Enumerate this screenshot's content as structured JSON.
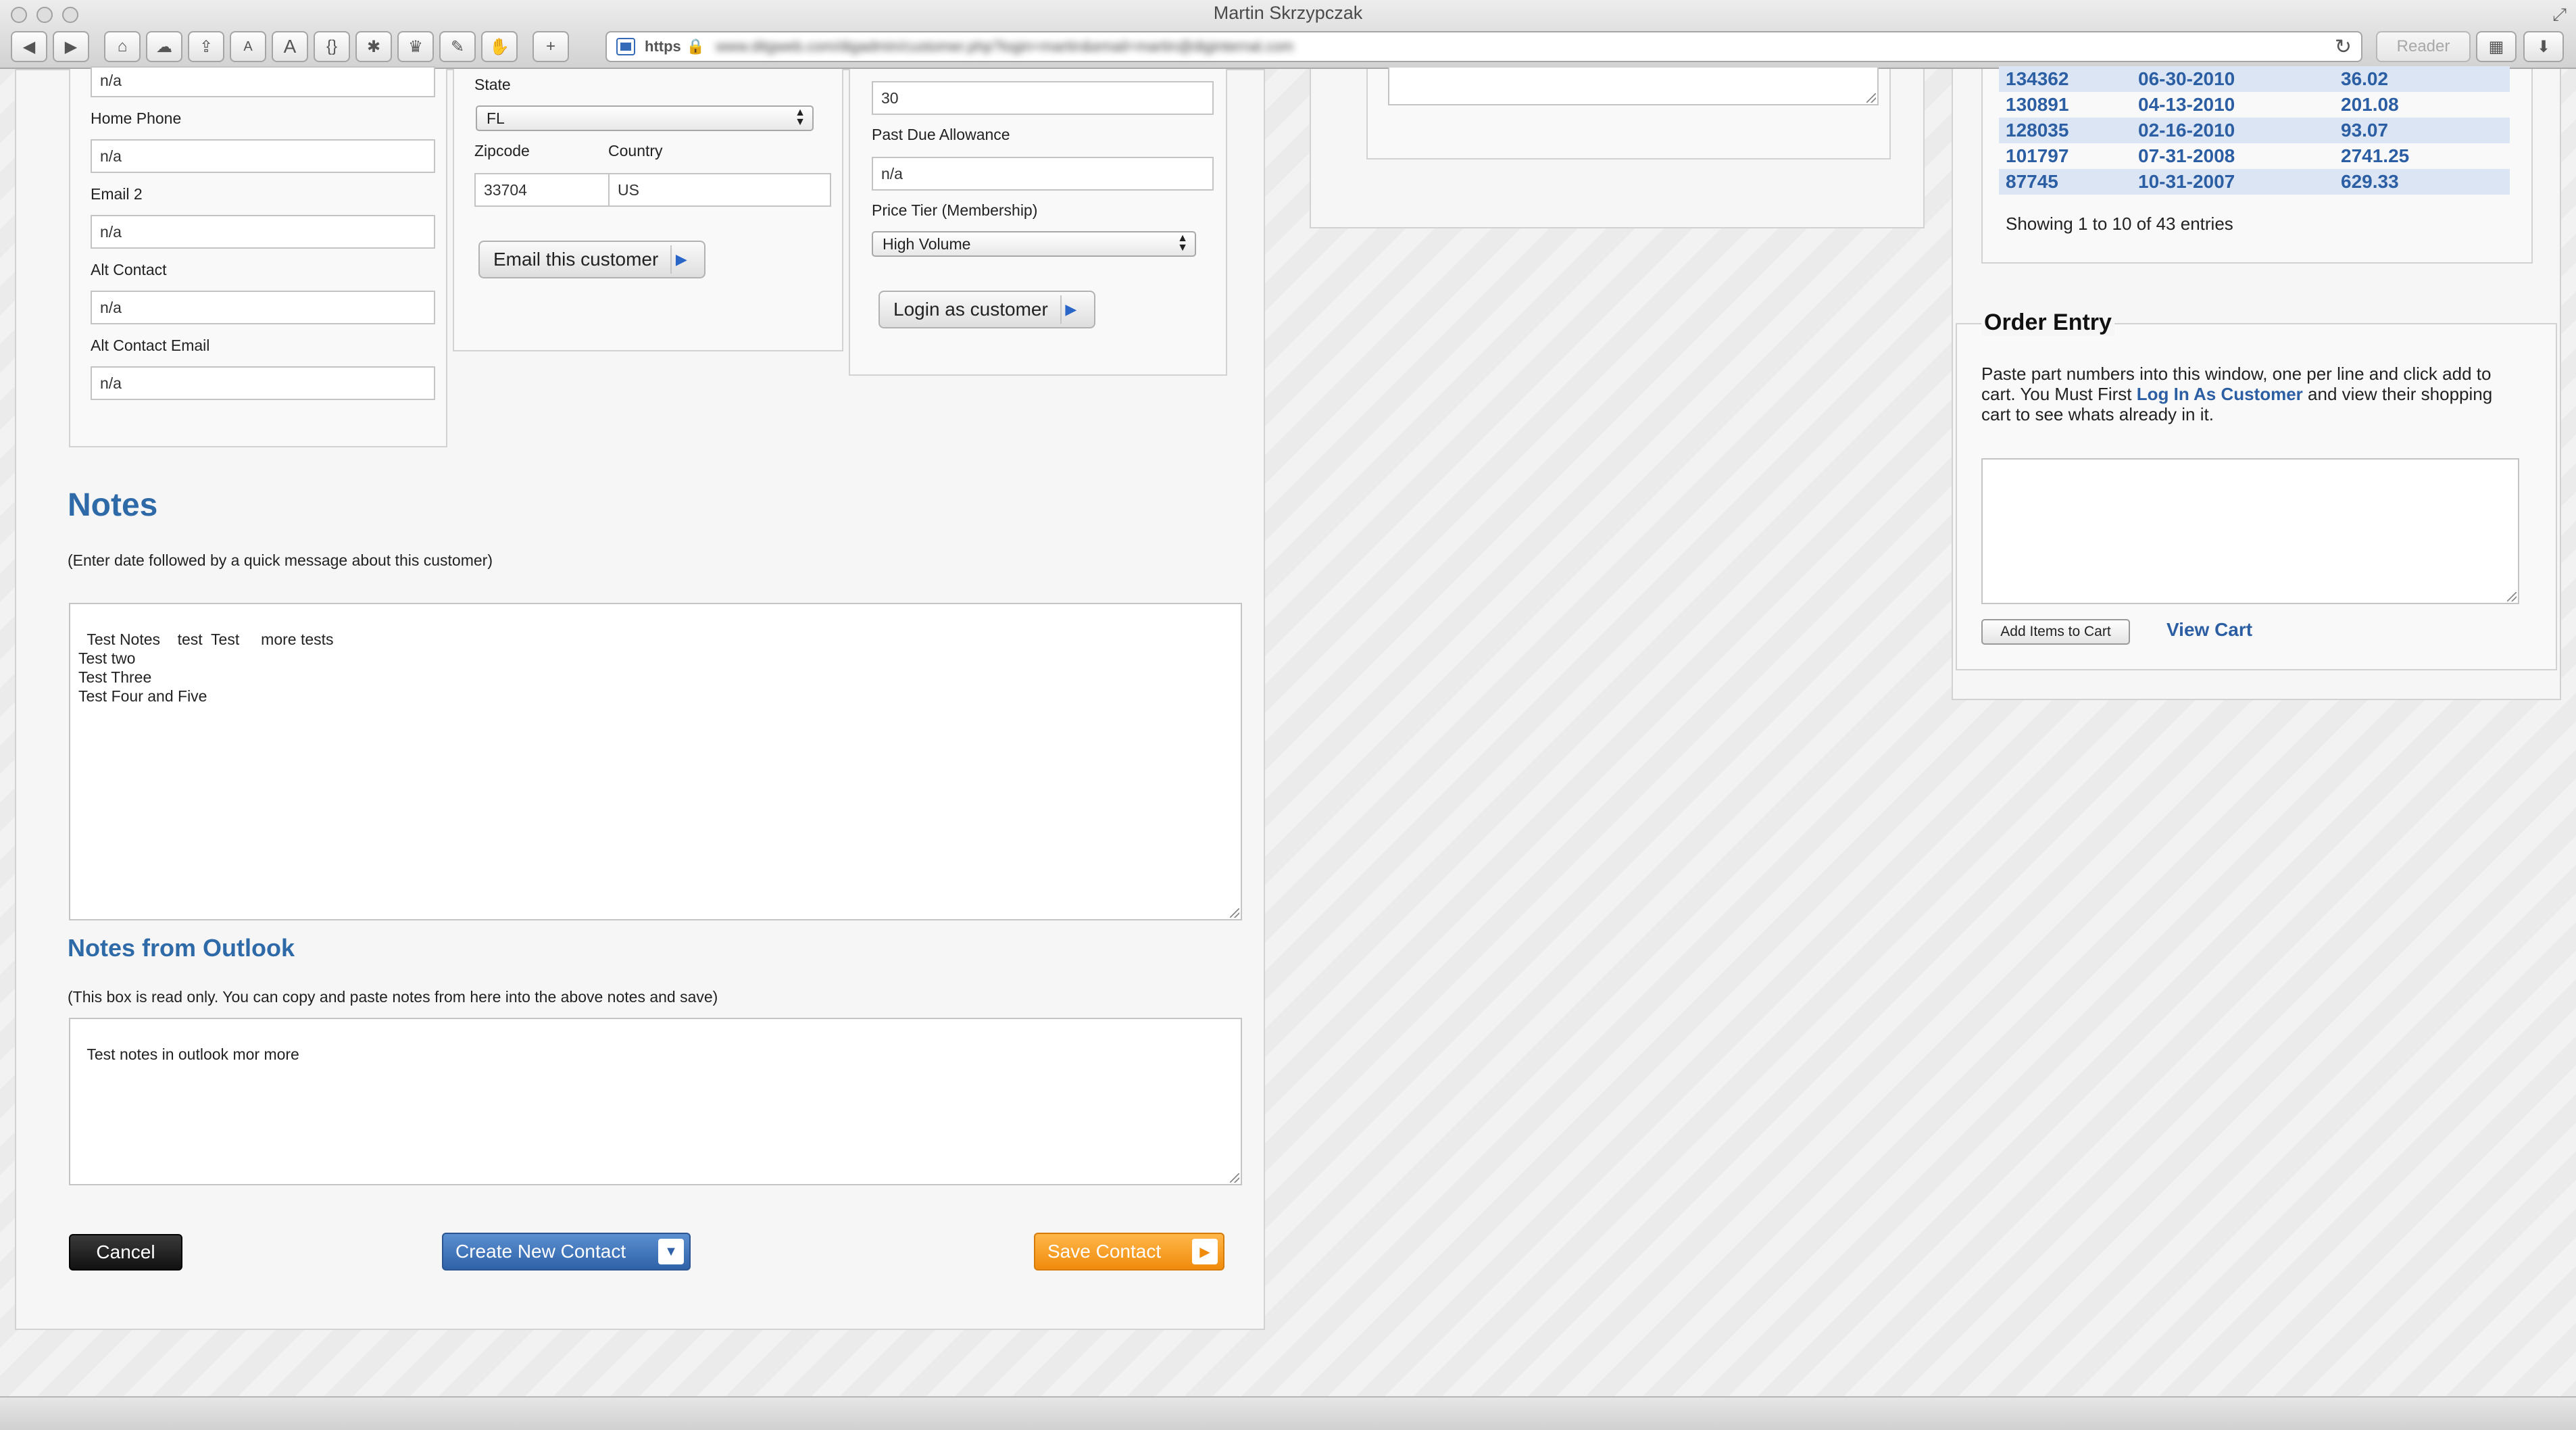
{
  "window": {
    "title": "Martin Skrzypczak"
  },
  "toolbar": {
    "back": "◀",
    "forward": "▶",
    "home": "⌂",
    "cloud": "☁",
    "share": "⇪",
    "font_small": "A",
    "font_large": "A",
    "code": "{}",
    "bug": "✱",
    "crown": "♛",
    "wrench": "✎",
    "hand": "✋",
    "add": "+"
  },
  "url": {
    "scheme": "https",
    "lock": "🔒",
    "text": "www.ditgweb.com/digadmin/customer.php?login=martin&email=martin@diginternal.com",
    "reload": "↻",
    "reader": "Reader"
  },
  "contact": {
    "top_value": "n/a",
    "home_phone_label": "Home Phone",
    "home_phone": "n/a",
    "email2_label": "Email 2",
    "email2": "n/a",
    "alt_contact_label": "Alt Contact",
    "alt_contact": "n/a",
    "alt_contact_email_label": "Alt Contact Email",
    "alt_contact_email": "n/a"
  },
  "address": {
    "state_label": "State",
    "state": "FL",
    "zipcode_label": "Zipcode",
    "zipcode": "33704",
    "country_label": "Country",
    "country": "US",
    "email_button": "Email this customer"
  },
  "account": {
    "terms_value": "30",
    "past_due_label": "Past Due Allowance",
    "past_due": "n/a",
    "price_tier_label": "Price Tier (Membership)",
    "price_tier": "High Volume",
    "login_button": "Login as customer"
  },
  "notes": {
    "title": "Notes",
    "hint": "(Enter date followed by a quick message about this customer)",
    "content": "Test Notes    test  Test     more tests\nTest two\nTest Three\nTest Four and Five"
  },
  "outlook": {
    "title": "Notes from Outlook",
    "hint": "(This box is read only. You can copy and paste notes from here into the above notes and save)",
    "content": "Test notes in outlook mor more"
  },
  "actions": {
    "cancel": "Cancel",
    "create": "Create New Contact",
    "save": "Save Contact"
  },
  "orders": {
    "rows": [
      {
        "id": "134362",
        "date": "06-30-2010",
        "amount": "36.02"
      },
      {
        "id": "130891",
        "date": "04-13-2010",
        "amount": "201.08"
      },
      {
        "id": "128035",
        "date": "02-16-2010",
        "amount": "93.07"
      },
      {
        "id": "101797",
        "date": "07-31-2008",
        "amount": "2741.25"
      },
      {
        "id": "87745",
        "date": "10-31-2007",
        "amount": "629.33"
      }
    ],
    "showing": "Showing 1 to 10 of 43 entries"
  },
  "order_entry": {
    "title": "Order Entry",
    "text_before": "Paste part numbers into this window, one per line and click add to cart. You Must First ",
    "link": "Log In As Customer",
    "text_after": " and view their shopping cart to see whats already in it.",
    "add_button": "Add Items to Cart",
    "view_cart": "View Cart"
  }
}
